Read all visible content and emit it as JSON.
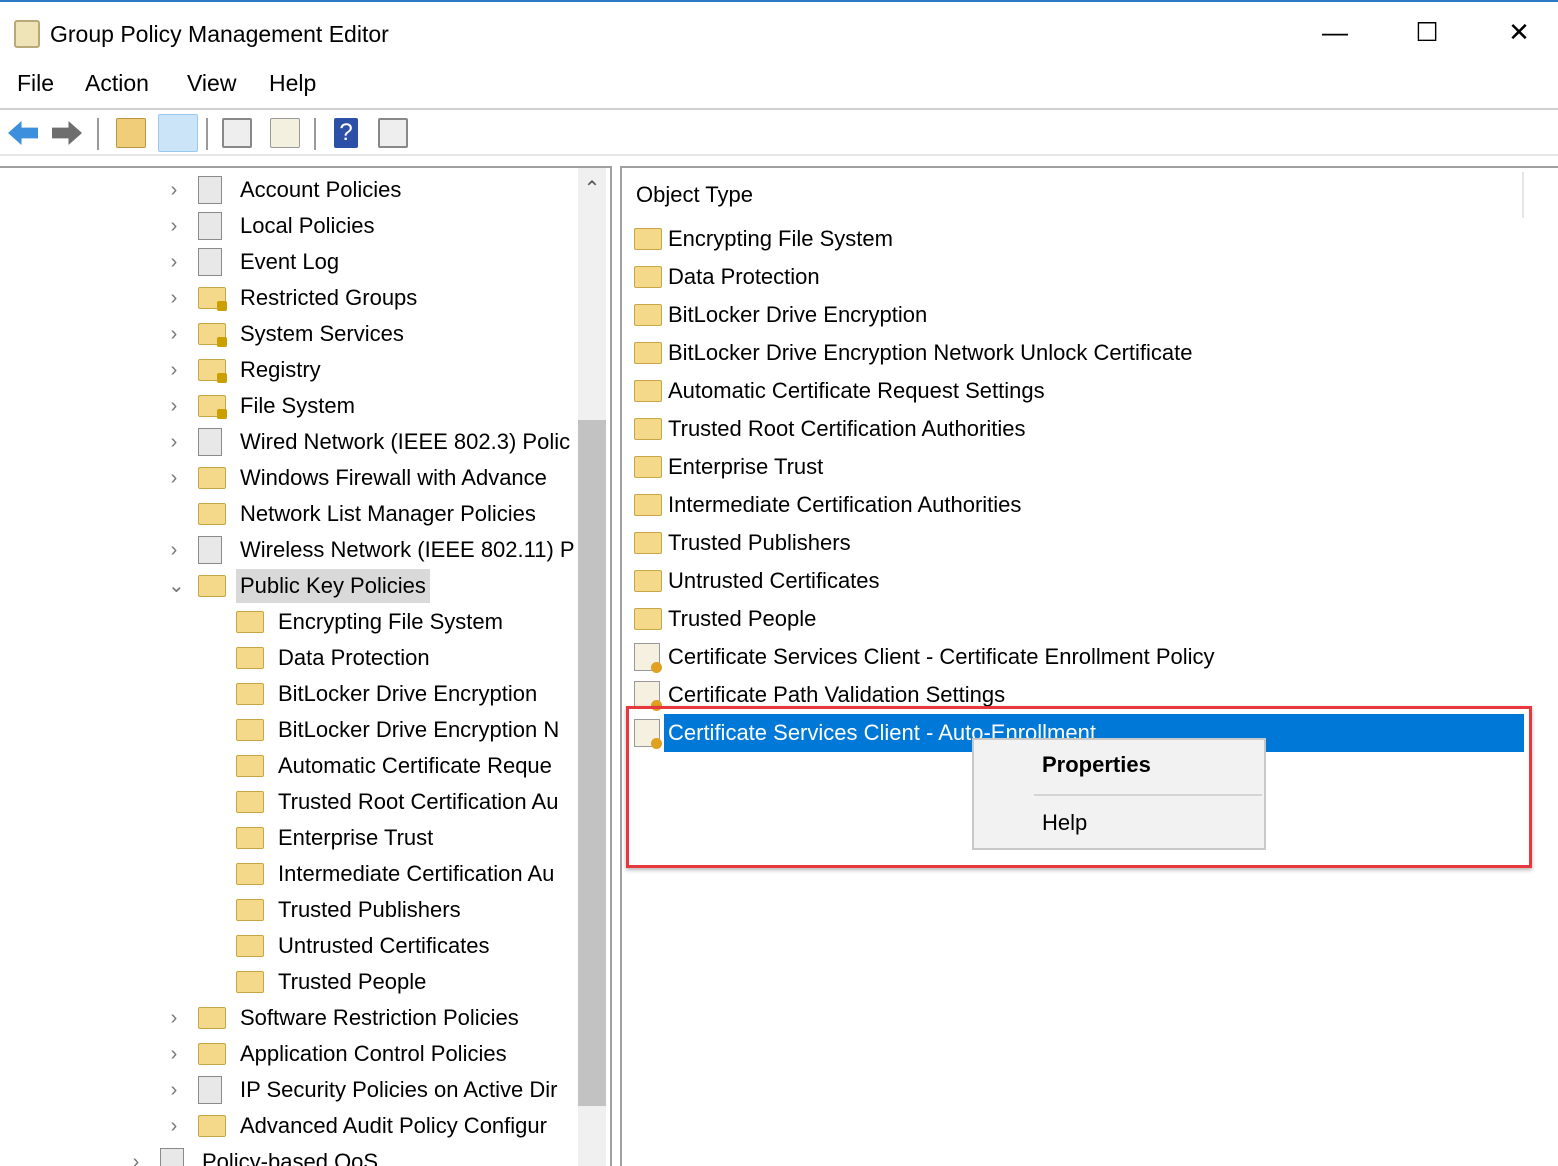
{
  "window": {
    "title": "Group Policy Management Editor",
    "minimize": "—",
    "maximize": "☐",
    "close": "✕"
  },
  "menu": [
    "File",
    "Action",
    "View",
    "Help"
  ],
  "toolbar": [
    "back-icon",
    "forward-icon",
    "up-folder-icon",
    "show-hide-tree-icon",
    "properties-icon",
    "export-list-icon",
    "help-icon",
    "show-action-pane-icon"
  ],
  "tree": [
    {
      "label": "Account Policies",
      "level": 1,
      "icon": "policy",
      "chevron": "›"
    },
    {
      "label": "Local Policies",
      "level": 1,
      "icon": "policy",
      "chevron": "›"
    },
    {
      "label": "Event Log",
      "level": 1,
      "icon": "policy",
      "chevron": "›"
    },
    {
      "label": "Restricted Groups",
      "level": 1,
      "icon": "lock",
      "chevron": "›"
    },
    {
      "label": "System Services",
      "level": 1,
      "icon": "lock",
      "chevron": "›"
    },
    {
      "label": "Registry",
      "level": 1,
      "icon": "lock",
      "chevron": "›"
    },
    {
      "label": "File System",
      "level": 1,
      "icon": "lock",
      "chevron": "›"
    },
    {
      "label": "Wired Network (IEEE 802.3) Polic",
      "level": 1,
      "icon": "policy",
      "chevron": "›"
    },
    {
      "label": "Windows Firewall with Advance",
      "level": 1,
      "icon": "folder",
      "chevron": "›"
    },
    {
      "label": "Network List Manager Policies",
      "level": 1,
      "icon": "folder",
      "chevron": ""
    },
    {
      "label": "Wireless Network (IEEE 802.11) P",
      "level": 1,
      "icon": "policy",
      "chevron": "›"
    },
    {
      "label": "Public Key Policies",
      "level": 1,
      "icon": "folder",
      "chevron": "⌄",
      "selected": true
    },
    {
      "label": "Encrypting File System",
      "level": 2,
      "icon": "folder",
      "chevron": ""
    },
    {
      "label": "Data Protection",
      "level": 2,
      "icon": "folder",
      "chevron": ""
    },
    {
      "label": "BitLocker Drive Encryption",
      "level": 2,
      "icon": "folder",
      "chevron": ""
    },
    {
      "label": "BitLocker Drive Encryption N",
      "level": 2,
      "icon": "folder",
      "chevron": ""
    },
    {
      "label": "Automatic Certificate Reque",
      "level": 2,
      "icon": "folder",
      "chevron": ""
    },
    {
      "label": "Trusted Root Certification Au",
      "level": 2,
      "icon": "folder",
      "chevron": ""
    },
    {
      "label": "Enterprise Trust",
      "level": 2,
      "icon": "folder",
      "chevron": ""
    },
    {
      "label": "Intermediate Certification Au",
      "level": 2,
      "icon": "folder",
      "chevron": ""
    },
    {
      "label": "Trusted Publishers",
      "level": 2,
      "icon": "folder",
      "chevron": ""
    },
    {
      "label": "Untrusted Certificates",
      "level": 2,
      "icon": "folder",
      "chevron": ""
    },
    {
      "label": "Trusted People",
      "level": 2,
      "icon": "folder",
      "chevron": ""
    },
    {
      "label": "Software Restriction Policies",
      "level": 1,
      "icon": "folder",
      "chevron": "›"
    },
    {
      "label": "Application Control Policies",
      "level": 1,
      "icon": "folder",
      "chevron": "›"
    },
    {
      "label": "IP Security Policies on Active Dir",
      "level": 1,
      "icon": "policy",
      "chevron": "›"
    },
    {
      "label": "Advanced Audit Policy Configur",
      "level": 1,
      "icon": "folder",
      "chevron": "›"
    },
    {
      "label": "Policy-based QoS",
      "level": 0,
      "icon": "policy",
      "chevron": "›"
    }
  ],
  "list": {
    "column": "Object Type",
    "items": [
      {
        "label": "Encrypting File System",
        "icon": "folder"
      },
      {
        "label": "Data Protection",
        "icon": "folder"
      },
      {
        "label": "BitLocker Drive Encryption",
        "icon": "folder"
      },
      {
        "label": "BitLocker Drive Encryption Network Unlock Certificate",
        "icon": "folder"
      },
      {
        "label": "Automatic Certificate Request Settings",
        "icon": "folder"
      },
      {
        "label": "Trusted Root Certification Authorities",
        "icon": "folder"
      },
      {
        "label": "Enterprise Trust",
        "icon": "folder"
      },
      {
        "label": "Intermediate Certification Authorities",
        "icon": "folder"
      },
      {
        "label": "Trusted Publishers",
        "icon": "folder"
      },
      {
        "label": "Untrusted Certificates",
        "icon": "folder"
      },
      {
        "label": "Trusted People",
        "icon": "folder"
      },
      {
        "label": "Certificate Services Client - Certificate Enrollment Policy",
        "icon": "cert"
      },
      {
        "label": "Certificate Path Validation Settings",
        "icon": "cert"
      },
      {
        "label": "Certificate Services Client - Auto-Enrollment",
        "icon": "cert",
        "selected": true
      }
    ]
  },
  "context_menu": {
    "properties": "Properties",
    "help": "Help"
  },
  "colors": {
    "selection": "#0078d7",
    "highlight_box": "#e8383d"
  }
}
